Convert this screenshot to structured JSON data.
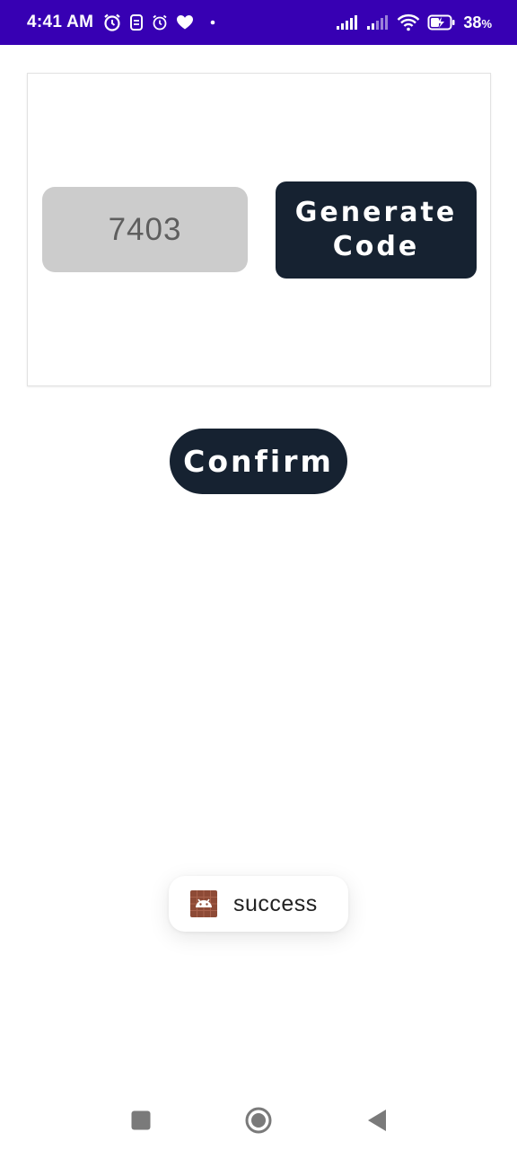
{
  "status_bar": {
    "time": "4:41 AM",
    "battery_percent": "38",
    "battery_unit": "%",
    "icons": [
      "alarm-icon",
      "sim-icon",
      "alarm-clock-icon",
      "heart-icon",
      "dot-icon",
      "signal-icon",
      "signal-icon",
      "wifi-icon",
      "battery-charging-icon"
    ]
  },
  "card": {
    "code_value": "7403",
    "generate_label": "Generate\nCode"
  },
  "confirm_label": "Confirm",
  "toast": {
    "message": "success",
    "icon": "android-icon"
  },
  "nav": {
    "icons": [
      "recents-icon",
      "home-icon",
      "back-icon"
    ]
  },
  "colors": {
    "status_bar": "#3700b3",
    "button": "#162231",
    "code_bg": "#cccccc"
  }
}
